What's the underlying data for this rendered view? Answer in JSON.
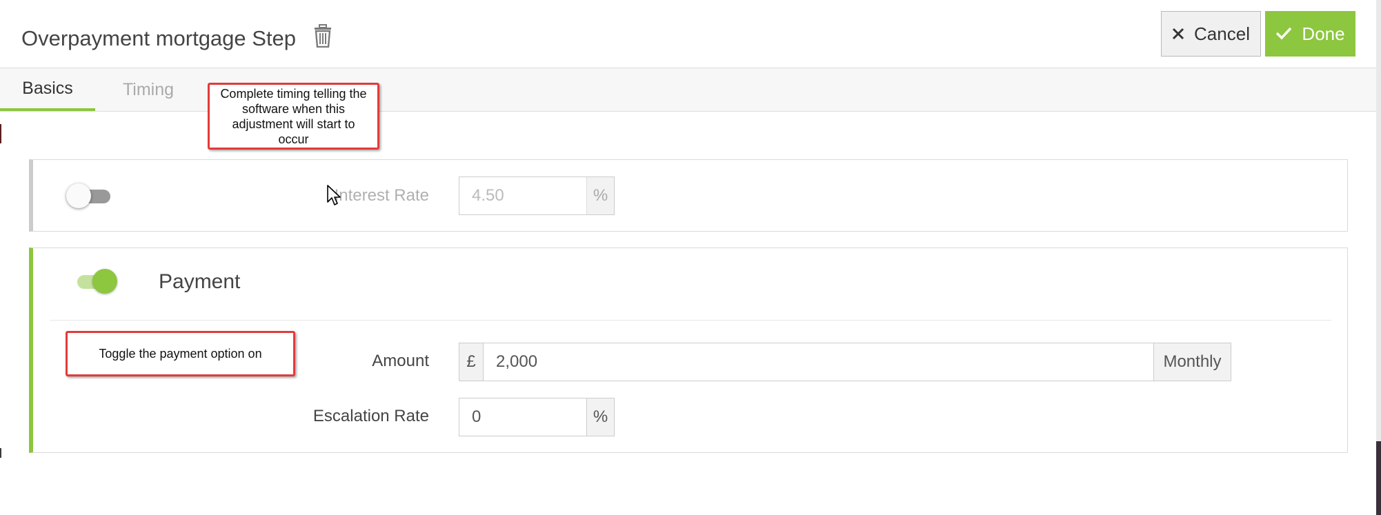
{
  "header": {
    "title": "Overpayment mortgage Step",
    "cancel_label": "Cancel",
    "done_label": "Done"
  },
  "tabs": [
    {
      "label": "Basics",
      "active": true
    },
    {
      "label": "Timing",
      "active": false
    }
  ],
  "annotations": {
    "timing_note": "Complete timing telling the software when this adjustment will start to occur",
    "payment_note": "Toggle the payment option on"
  },
  "interest_rate": {
    "enabled": false,
    "label": "Interest Rate",
    "value": "4.50",
    "unit": "%"
  },
  "payment": {
    "enabled": true,
    "title": "Payment",
    "amount_label": "Amount",
    "currency": "£",
    "amount_value": "2,000",
    "frequency": "Monthly",
    "escalation_label": "Escalation Rate",
    "escalation_value": "0",
    "escalation_unit": "%"
  },
  "colors": {
    "accent": "#8dc63f",
    "annotation_border": "#e23b3b",
    "disabled_text": "#b0b0b0"
  },
  "icons": {
    "trash": "trash-icon",
    "cancel": "close-icon",
    "done": "check-icon",
    "cursor": "mouse-cursor-icon"
  }
}
